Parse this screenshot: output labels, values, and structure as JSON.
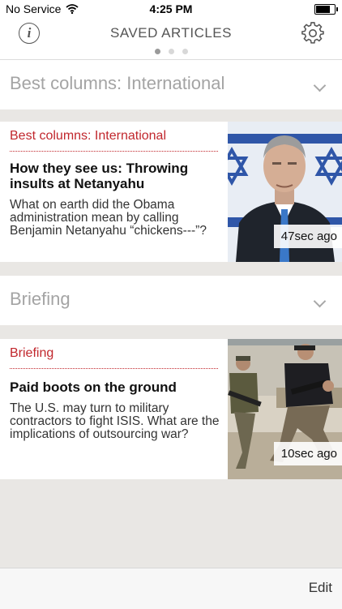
{
  "status_bar": {
    "carrier": "No Service",
    "time": "4:25 PM"
  },
  "nav": {
    "title": "SAVED ARTICLES",
    "info_icon": "info-icon",
    "settings_icon": "gear-icon",
    "page_dots": 3,
    "active_dot": 1
  },
  "sections": [
    {
      "header": "Best columns: International",
      "article": {
        "kicker": "Best columns: International",
        "headline": "How they see us: Throwing insults at Netanyahu",
        "summary": "What on earth did the Obama administration mean by calling Benjamin Netanyahu “chickens---”?",
        "age": "47sec ago"
      }
    },
    {
      "header": "Briefing",
      "article": {
        "kicker": "Briefing",
        "headline": "Paid boots on the ground",
        "summary": "The U.S. may turn to military contractors to fight ISIS. What are the implications of outsourcing war?",
        "age": "10sec ago"
      }
    }
  ],
  "toolbar": {
    "edit_label": "Edit"
  },
  "colors": {
    "accent_red": "#c1272d",
    "background": "#e9e7e4"
  }
}
